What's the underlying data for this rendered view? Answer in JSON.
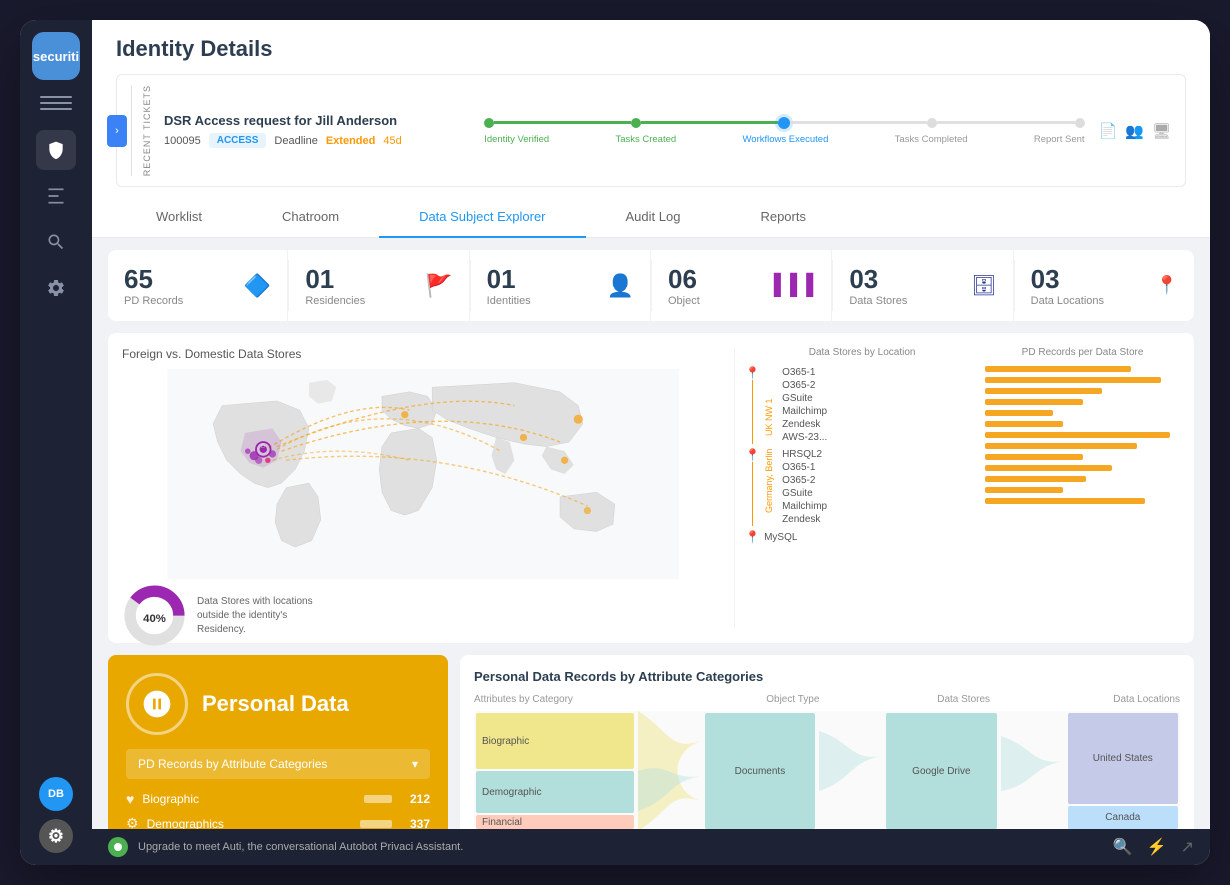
{
  "app": {
    "logo": "securiti",
    "title": "Identity Details"
  },
  "sidebar": {
    "icons": [
      "menu",
      "shield",
      "chart",
      "search",
      "settings"
    ],
    "bottom_avatars": [
      {
        "label": "DB",
        "color": "#2196F3"
      },
      {
        "label": "⚙",
        "color": "#555"
      }
    ]
  },
  "ticket": {
    "title": "DSR Access request for Jill Anderson",
    "id": "100095",
    "type": "ACCESS",
    "deadline_label": "Deadline",
    "extended_label": "Extended",
    "days": "45d",
    "progress_steps": [
      {
        "label": "Identity Verified",
        "state": "done"
      },
      {
        "label": "Tasks Created",
        "state": "done"
      },
      {
        "label": "Workflows Executed",
        "state": "active"
      },
      {
        "label": "Tasks Completed",
        "state": "pending"
      },
      {
        "label": "Report Sent",
        "state": "pending"
      }
    ]
  },
  "tabs": [
    {
      "label": "Worklist",
      "active": false
    },
    {
      "label": "Chatroom",
      "active": false
    },
    {
      "label": "Data Subject Explorer",
      "active": true
    },
    {
      "label": "Audit Log",
      "active": false
    },
    {
      "label": "Reports",
      "active": false
    }
  ],
  "stats": [
    {
      "number": "65",
      "label": "PD Records",
      "icon": "🔶"
    },
    {
      "number": "01",
      "label": "Residencies",
      "icon": "🚩"
    },
    {
      "number": "01",
      "label": "Identities",
      "icon": "👤"
    },
    {
      "number": "06",
      "label": "Object",
      "icon": "|||"
    },
    {
      "number": "03",
      "label": "Data Stores",
      "icon": "🗄"
    },
    {
      "number": "03",
      "label": "Data Locations",
      "icon": "📍"
    }
  ],
  "map": {
    "title": "Foreign vs. Domestic Data Stores",
    "donut_percent": "40%",
    "donut_label": "Data Stores with locations outside the identity's Residency.",
    "col1_title": "Data Stores by Location",
    "col2_title": "PD Records per Data Store",
    "uk_region": "UK NW 1",
    "uk_stores": [
      "O365-1",
      "O365-2",
      "GSuite",
      "Mailchimp",
      "Zendesk",
      "AWS-23..."
    ],
    "berlin_region": "Germany, Berlin",
    "berlin_stores": [
      "HRSQL2",
      "O365-1",
      "O365-2",
      "GSuite",
      "Mailchimp",
      "Zendesk"
    ],
    "extra_stores": [
      "MySQL"
    ],
    "bar_widths": [
      90,
      110,
      75,
      60,
      45,
      50,
      120,
      95,
      60,
      80,
      65,
      50,
      100
    ]
  },
  "personal_data": {
    "icon": "⬡",
    "title": "Personal Data",
    "dropdown_label": "PD Records by Attribute Categories",
    "items": [
      {
        "icon": "♥",
        "label": "Biographic",
        "count": "212"
      },
      {
        "icon": "⚙",
        "label": "Demographics",
        "count": "337"
      }
    ]
  },
  "records": {
    "title": "Personal Data Records by Attribute Categories",
    "col_headers": [
      "Attributes by Category",
      "Object Type",
      "Data Stores",
      "Data Locations"
    ],
    "categories": [
      "Biographic",
      "Demographic",
      "Financial"
    ],
    "object_types": [
      "Documents"
    ],
    "data_stores": [
      "Google Drive"
    ],
    "data_locations": [
      "United States",
      "Canada"
    ]
  },
  "status_bar": {
    "text": "Upgrade to meet Auti, the conversational Autobot Privaci Assistant."
  }
}
